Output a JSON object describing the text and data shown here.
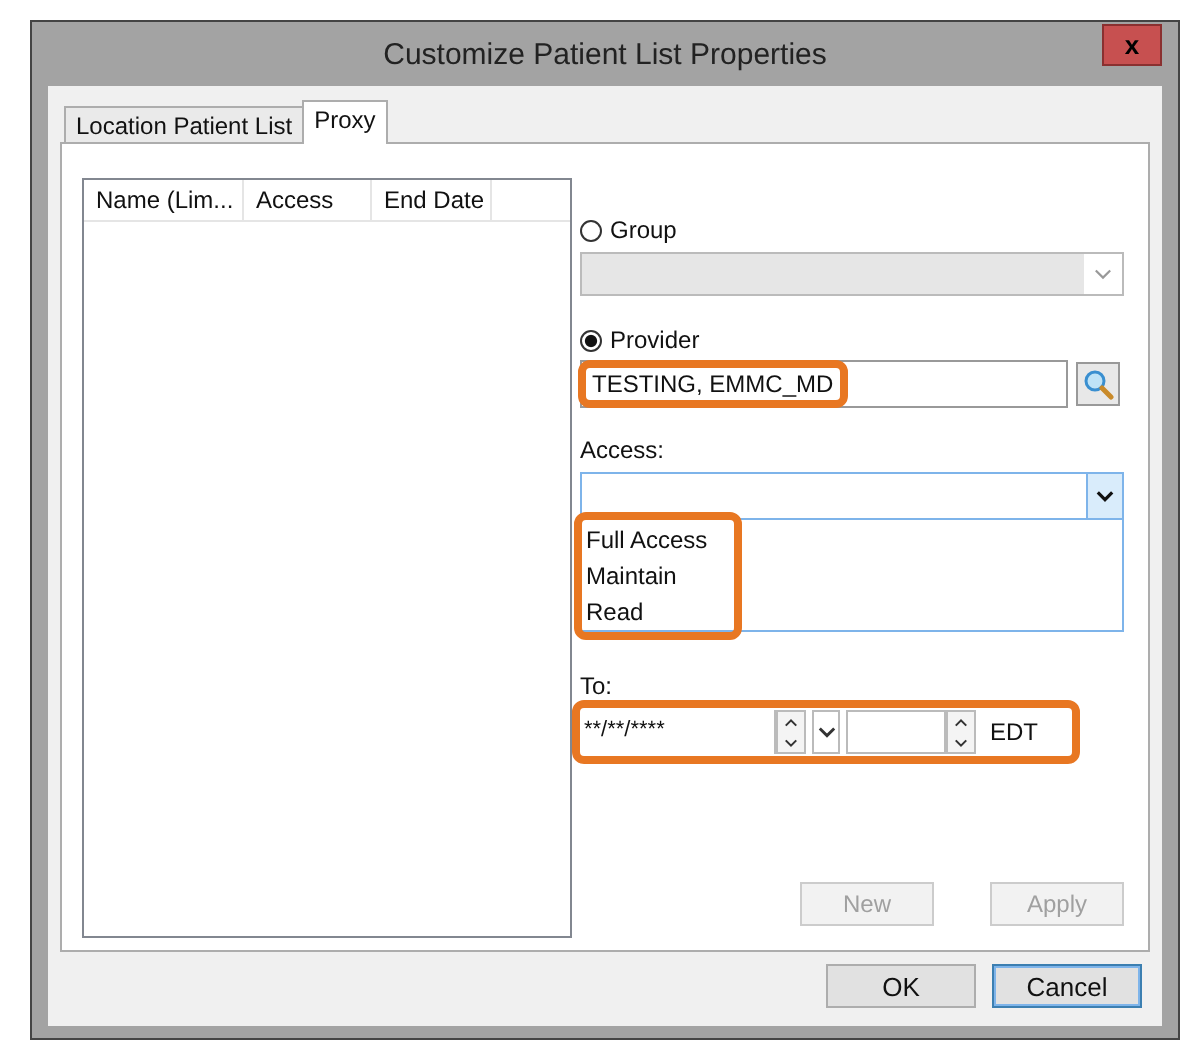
{
  "window": {
    "title": "Customize Patient List Properties",
    "close": "x"
  },
  "tabs": [
    {
      "label": "Location Patient List",
      "selected": false
    },
    {
      "label": "Proxy",
      "selected": true
    }
  ],
  "proxy_list": {
    "columns": [
      "Name (Lim...",
      "Access",
      "End Date"
    ]
  },
  "group": {
    "label": "Group",
    "selected": false
  },
  "provider": {
    "label": "Provider",
    "selected": true,
    "value": "TESTING, EMMC_MD",
    "highlighted": true
  },
  "access": {
    "label": "Access:",
    "expanded": true,
    "highlighted": true,
    "options": [
      "Full Access",
      "Maintain",
      "Read"
    ]
  },
  "to": {
    "label": "To:",
    "date": "**/**/****",
    "timezone": "EDT",
    "highlighted": true
  },
  "actions": [
    {
      "label": "New",
      "disabled": true
    },
    {
      "label": "Apply",
      "disabled": true
    }
  ],
  "buttons": [
    {
      "label": "OK",
      "focused": false
    },
    {
      "label": "Cancel",
      "focused": true
    }
  ]
}
